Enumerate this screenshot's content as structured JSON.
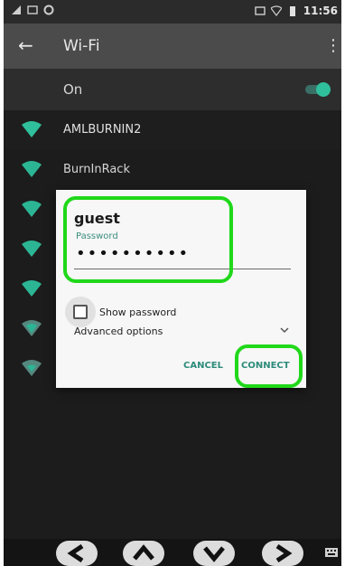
{
  "status": {
    "time": "11:56"
  },
  "appbar": {
    "title": "Wi-Fi"
  },
  "toggle": {
    "label": "On"
  },
  "networks": [
    {
      "name": "AMLBURNIN2"
    },
    {
      "name": "BurnInRack"
    }
  ],
  "dialog": {
    "ssid": "guest",
    "password_label": "Password",
    "password_masked": "••••••••••",
    "show_password_label": "Show password",
    "advanced_options_label": "Advanced options",
    "cancel_label": "CANCEL",
    "connect_label": "CONNECT"
  },
  "colors": {
    "accent": "#2c8b7a",
    "highlight": "#20d81a"
  }
}
